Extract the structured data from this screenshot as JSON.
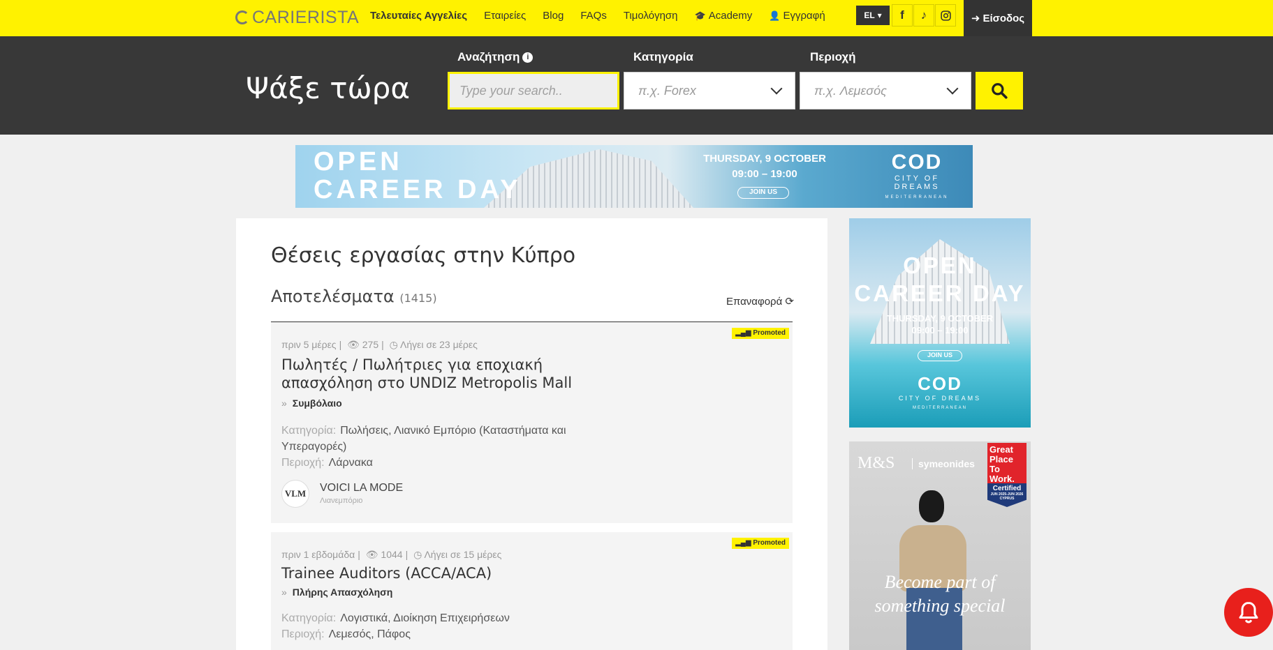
{
  "nav": {
    "logo": "CARIERISTA",
    "links": [
      {
        "label": "Τελευταίες Αγγελίες"
      },
      {
        "label": "Εταιρείες"
      },
      {
        "label": "Blog"
      },
      {
        "label": "FAQs"
      },
      {
        "label": "Τιμολόγηση"
      },
      {
        "label": "Academy",
        "icon": "graduation-cap-icon"
      },
      {
        "label": "Εγγραφή",
        "icon": "user-plus-icon"
      }
    ],
    "language": "EL",
    "social": [
      "facebook-icon",
      "tiktok-icon",
      "instagram-icon"
    ],
    "login_label": "Είσοδος",
    "accent_color": "#fff200"
  },
  "search": {
    "heading": "Ψάξε τώρα",
    "keyword_label": "Αναζήτηση",
    "keyword_placeholder": "Type your search..",
    "category_label": "Κατηγορία",
    "category_placeholder": "π.χ. Forex",
    "region_label": "Περιοχή",
    "region_placeholder": "π.χ. Λεμεσός"
  },
  "top_banner": {
    "title_line1": "OPEN",
    "title_line2": "CAREER DAY",
    "date": "THURSDAY, 9 OCTOBER",
    "time": "09:00 – 19:00",
    "cta": "JOIN US",
    "logo_mark": "COD",
    "logo_name": "CITY OF DREAMS",
    "logo_sub": "MEDITERRANEAN"
  },
  "listing": {
    "page_title": "Θέσεις εργασίας στην Κύπρο",
    "results_label": "Αποτελέσματα",
    "results_count": "(1415)",
    "reset_label": "Επαναφορά",
    "jobs": [
      {
        "promoted": "Promoted",
        "posted": "πριν 5 μέρες",
        "views": "275",
        "expires": "Λήγει σε 23 μέρες",
        "title_line1": "Πωλητές / Πωλήτριες για εποχιακή",
        "title_line2": "απασχόληση στο UNDIZ Metropolis Mall",
        "type": "Συμβόλαιο",
        "category_label": "Κατηγορία:",
        "category": "Πωλήσεις,  Λιανικό Εμπόριο (Καταστήματα και Υπεραγορές)",
        "region_label": "Περιοχή:",
        "region": "Λάρνακα",
        "company_logo": "VLM",
        "company": "VOICI LA MODE",
        "company_sector": "Λιανεμπόριο"
      },
      {
        "promoted": "Promoted",
        "posted": "πριν 1 εβδομάδα",
        "views": "1044",
        "expires": "Λήγει σε 15 μέρες",
        "title_line1": "Trainee Auditors (ACCA/ACA)",
        "type": "Πλήρης Απασχόληση",
        "category_label": "Κατηγορία:",
        "category": "Λογιστικά,  Διοίκηση Επιχειρήσεων",
        "region_label": "Περιοχή:",
        "region": "Λεμεσός,  Πάφος"
      }
    ]
  },
  "side_ad1": {
    "title_line1": "OPEN",
    "title_line2": "CAREER DAY",
    "date": "THURSDAY, 9 OCTOBER",
    "time": "09:00 – 19:00",
    "cta": "JOIN US",
    "logo_mark": "COD",
    "logo_name": "CITY OF DREAMS",
    "logo_sub": "MEDITERRANEAN"
  },
  "side_ad2": {
    "brand": "M&S",
    "brand2": "symeonides",
    "gptw_line1": "Great",
    "gptw_line2": "Place",
    "gptw_line3": "To",
    "gptw_line4": "Work.",
    "gptw_cert": "Certified",
    "gptw_dates": "JUN 2025-JUN 2026",
    "gptw_country": "CYPRUS",
    "slogan_line1": "Become part of",
    "slogan_line2": "something special"
  }
}
